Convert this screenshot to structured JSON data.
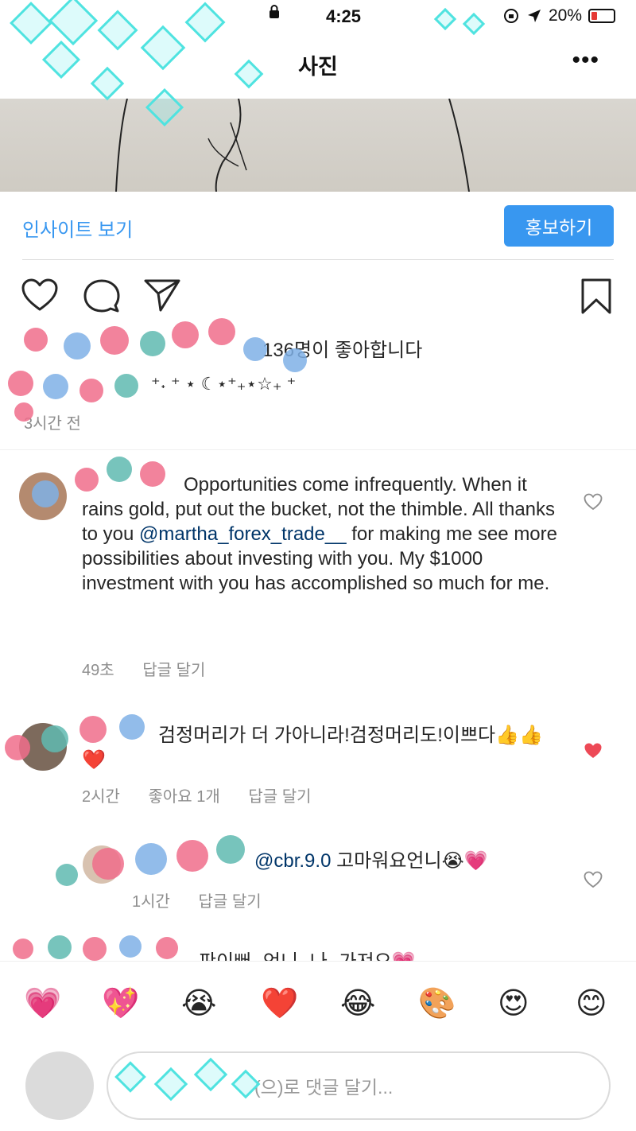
{
  "status_bar": {
    "time": "4:25",
    "battery": "20%"
  },
  "header": {
    "title": "사진",
    "more_label": "•••"
  },
  "insights": {
    "link_label": "인사이트 보기",
    "promote_label": "홍보하기"
  },
  "likes_text": "136명이 좋아합니다",
  "caption_text": "⁺˖ ⁺ ⋆ ☾⋆⁺₊⋆☆₊ ⁺",
  "post_time": "3시간 전",
  "comments": [
    {
      "text_a": "Opportunities come infrequently. When it rains gold, put out the bucket, not the thimble. All thanks to you ",
      "mention": "@martha_forex_trade__",
      "text_b": " for making me see more possibilities about investing with you. My $1000 investment with you has accomplished so much for me.",
      "time": "49초",
      "reply": "답글 달기",
      "liked": false
    },
    {
      "text": "검정머리가 더 가아니라!검정머리도!이쁘다👍👍❤️",
      "time": "2시간",
      "likes": "좋아요 1개",
      "reply": "답글 달기",
      "liked": true
    },
    {
      "mention": "@cbr.9.0",
      "text": " 고마워요언니😭💗",
      "time": "1시간",
      "reply": "답글 달기",
      "liked": false
    },
    {
      "text": "판이뻐 언니 나 가져요💗",
      "partial": true
    }
  ],
  "emojis": [
    "💗",
    "💖",
    "😭",
    "❤️",
    "😂",
    "🎨",
    "😍",
    "😊"
  ],
  "comment_input": {
    "placeholder": "(으)로 댓글 달기..."
  },
  "colors": {
    "accent": "#3897f0",
    "heart_red": "#ed4956",
    "mention": "#003569",
    "muted": "#8e8e8e"
  }
}
